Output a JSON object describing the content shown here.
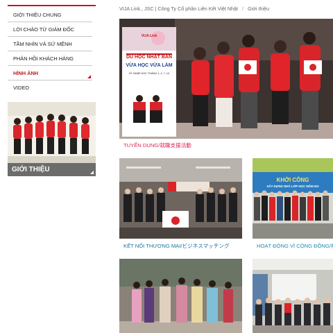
{
  "sidebar": {
    "items": [
      {
        "label": "Giới thiệu chung",
        "active": false
      },
      {
        "label": "Lời chào từ Giám đốc",
        "active": false
      },
      {
        "label": "Tầm nhìn và sứ mệnh",
        "active": false
      },
      {
        "label": "Phản hồi khách hàng",
        "active": false
      },
      {
        "label": "Hình ảnh",
        "active": true
      },
      {
        "label": "Video",
        "active": false
      }
    ],
    "section_title": "GIỚI THIỆU"
  },
  "breadcrumb": {
    "company": "VIJA Link., JSC | Công Ty Cổ phần Liên Kết Việt Nhật",
    "separator": "/",
    "current": "Giới thiệu"
  },
  "gallery": {
    "items": [
      {
        "caption": "TUYỂN DỤNG/就職支援活動"
      },
      {
        "caption": "KẾT NỐI THƯƠNG MẠI/ビジネスマッチング"
      },
      {
        "caption": "HOẠT ĐỘNG VÌ CỘNG ĐỒNG/社"
      }
    ],
    "poster": {
      "brand": "VIJA Link",
      "line1": "DU HỌC NHẬT BẢN",
      "line2": "VỪA HỌC VỪA LÀM",
      "line3": "KỲ NHẬP HỌC THÁNG 1, 4, 7, 10"
    },
    "banner": {
      "line1": "KHỞI CÔNG",
      "line2": "XÂY DỰNG NHÀ LỚP HỌC MẦM NO"
    }
  },
  "colors": {
    "accent_red": "#c8161d",
    "caption_pink": "#e0245e",
    "caption_blue": "#1a6fa3",
    "sidebar_bar": "#6c6c6c"
  }
}
